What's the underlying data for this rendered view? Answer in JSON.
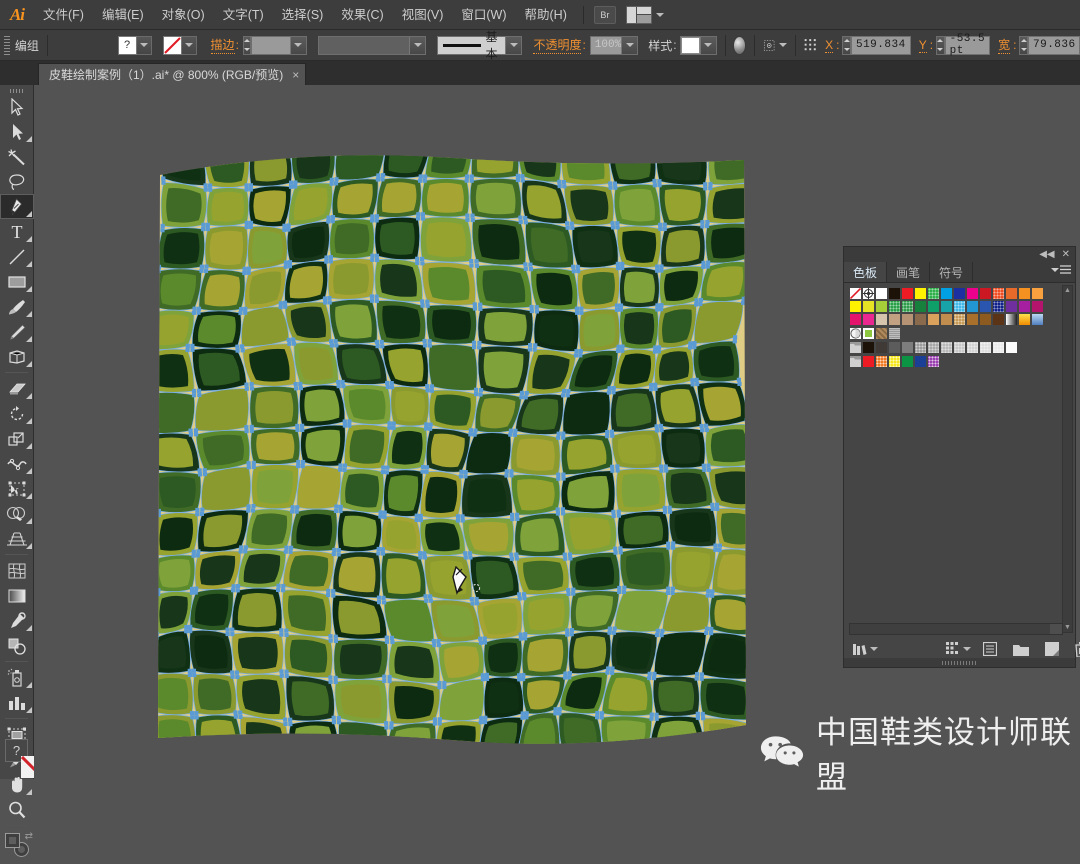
{
  "app": {
    "name": "Adobe Illustrator",
    "logo_text": "Ai"
  },
  "menubar": {
    "items": [
      {
        "label": "文件(F)",
        "name": "file"
      },
      {
        "label": "编辑(E)",
        "name": "edit"
      },
      {
        "label": "对象(O)",
        "name": "object"
      },
      {
        "label": "文字(T)",
        "name": "type"
      },
      {
        "label": "选择(S)",
        "name": "select"
      },
      {
        "label": "效果(C)",
        "name": "effect"
      },
      {
        "label": "视图(V)",
        "name": "view"
      },
      {
        "label": "窗口(W)",
        "name": "window"
      },
      {
        "label": "帮助(H)",
        "name": "help"
      }
    ],
    "bridge_label": "Br",
    "workspace_label": ""
  },
  "controlbar": {
    "selection_label": "编组",
    "fill_swatch_glyph": "?",
    "stroke_label": "描边",
    "stroke_weight_value": "",
    "profile_value": "",
    "brush_label": "基本",
    "opacity_label": "不透明度",
    "opacity_value": "100%",
    "style_label": "样式",
    "x_label": "X",
    "x_value": "519.834",
    "y_label": "Y",
    "y_value": "-53.5 pt",
    "w_label": "宽",
    "w_value": "79.836"
  },
  "document": {
    "tab_title": "皮鞋绘制案例（1）.ai* @ 800% (RGB/预览)",
    "close_glyph": "×",
    "zoom": "800%",
    "color_mode": "RGB",
    "view_mode": "预览"
  },
  "toolbar": {
    "tools": [
      {
        "name": "selection-tool",
        "label": "选择工具",
        "active": false
      },
      {
        "name": "direct-selection-tool",
        "label": "直接选择工具",
        "active": false
      },
      {
        "name": "magic-wand-tool",
        "label": "魔棒工具",
        "active": false
      },
      {
        "name": "lasso-tool",
        "label": "套索工具",
        "active": false
      },
      {
        "name": "pen-tool",
        "label": "钢笔工具",
        "active": true
      },
      {
        "name": "type-tool",
        "label": "文字工具",
        "active": false
      },
      {
        "name": "line-segment-tool",
        "label": "直线段工具",
        "active": false
      },
      {
        "name": "rectangle-tool",
        "label": "矩形工具",
        "active": false
      },
      {
        "name": "paintbrush-tool",
        "label": "画笔工具",
        "active": false
      },
      {
        "name": "pencil-tool",
        "label": "铅笔工具",
        "active": false
      },
      {
        "name": "blob-brush-tool",
        "label": "斑点画笔工具",
        "active": false
      },
      {
        "name": "eraser-tool",
        "label": "橡皮擦工具",
        "active": false
      },
      {
        "name": "rotate-tool",
        "label": "旋转工具",
        "active": false
      },
      {
        "name": "scale-tool",
        "label": "比例缩放工具",
        "active": false
      },
      {
        "name": "width-tool",
        "label": "宽度工具",
        "active": false
      },
      {
        "name": "free-transform-tool",
        "label": "自由变换工具",
        "active": false
      },
      {
        "name": "shape-builder-tool",
        "label": "形状生成器工具",
        "active": false
      },
      {
        "name": "perspective-grid-tool",
        "label": "透视网格工具",
        "active": false
      },
      {
        "name": "mesh-tool",
        "label": "网格工具",
        "active": false
      },
      {
        "name": "gradient-tool",
        "label": "渐变工具",
        "active": false
      },
      {
        "name": "eyedropper-tool",
        "label": "吸管工具",
        "active": false
      },
      {
        "name": "blend-tool",
        "label": "混合工具",
        "active": false
      },
      {
        "name": "symbol-sprayer-tool",
        "label": "符号喷枪工具",
        "active": false
      },
      {
        "name": "column-graph-tool",
        "label": "柱形图工具",
        "active": false
      },
      {
        "name": "artboard-tool",
        "label": "画板工具",
        "active": false
      },
      {
        "name": "slice-tool",
        "label": "切片工具",
        "active": false
      },
      {
        "name": "hand-tool",
        "label": "抓手工具",
        "active": false
      },
      {
        "name": "zoom-tool",
        "label": "缩放工具",
        "active": false
      }
    ],
    "fill_stroke_label": "填色和描边",
    "quick_label": "?"
  },
  "panel": {
    "collapse_glyph": "◀◀",
    "close_glyph": "✕",
    "tabs": [
      {
        "label": "色板",
        "name": "swatches",
        "active": true
      },
      {
        "label": "画笔",
        "name": "brushes",
        "active": false
      },
      {
        "label": "符号",
        "name": "symbols",
        "active": false
      }
    ],
    "swatch_rows": [
      [
        "none",
        "registration",
        "#ffffff",
        "#1d1208",
        "#ed1c24",
        "#fff200",
        "#2eb04a",
        "#00a0e3",
        "#1c2fa0",
        "#ec008c",
        "#cc1822",
        "#f04d23",
        "#e86a2a",
        "#f59120",
        "#f8a13e"
      ],
      [
        "#fff200",
        "#e6e224",
        "#a6ce39",
        "#2aa148",
        "#2e9c4b",
        "#17803c",
        "#0fa06a",
        "#17a3a8",
        "#41b9e8",
        "#2196d3",
        "#2b56b0",
        "#10228a",
        "#6f2f9f",
        "#a61fa0",
        "#b5146c"
      ],
      [
        "#e4136b",
        "#ea2890",
        "#d6c4ac",
        "#c2a183",
        "#b59374",
        "#8a6a4c",
        "#d9a15c",
        "#c08d4e",
        "#c79b56",
        "#a8702a",
        "#8d5a20",
        "#5b3418",
        "#ffffff",
        "#f7b30f",
        "#7aa9dc"
      ],
      [
        "#f2f2f2",
        "#a8d95c",
        "#c2a77e",
        "#a7a7a7"
      ],
      [
        "#9a9a9a",
        "#1d1208",
        "#403a36",
        "#5c5c5c",
        "#7d7d7d",
        "#9b9b9b",
        "#a9a9a9",
        "#b9b9b9",
        "#c8c8c8",
        "#d4d4d4",
        "#dedede",
        "#ebebeb",
        "#fbfbfb"
      ],
      [
        "#9a9a9a",
        "#ed1c24",
        "#f07922",
        "#f6e71d",
        "#0b9444",
        "#1b3f94",
        "#9a3fb0"
      ]
    ],
    "bottom_icons": [
      {
        "name": "swatch-libraries-menu-icon",
        "label": "色板库菜单"
      },
      {
        "name": "show-swatch-kinds-icon",
        "label": "显示色板类型菜单"
      },
      {
        "name": "swatch-options-icon",
        "label": "色板选项"
      },
      {
        "name": "new-color-group-icon",
        "label": "新建颜色组"
      },
      {
        "name": "new-swatch-icon",
        "label": "新建色板"
      },
      {
        "name": "delete-swatch-icon",
        "label": "删除色板"
      }
    ]
  },
  "artwork": {
    "description": "鳄鱼皮纹理矢量图案",
    "base_color": "#e0cd85",
    "scale_colors": [
      "#0d2b10",
      "#17361a",
      "#2d5a22",
      "#3f6b26",
      "#5b8a2c",
      "#7fa33a",
      "#96a32e",
      "#a6a534",
      "#8b9a2f",
      "#103013"
    ],
    "anchor_color": "#5b9bd5",
    "path_color": "#7ab0e8",
    "selection_active": true
  },
  "cursor": {
    "name": "pen-tool-cursor"
  },
  "watermark": {
    "text": "中国鞋类设计师联盟",
    "icon": "wechat-icon"
  }
}
